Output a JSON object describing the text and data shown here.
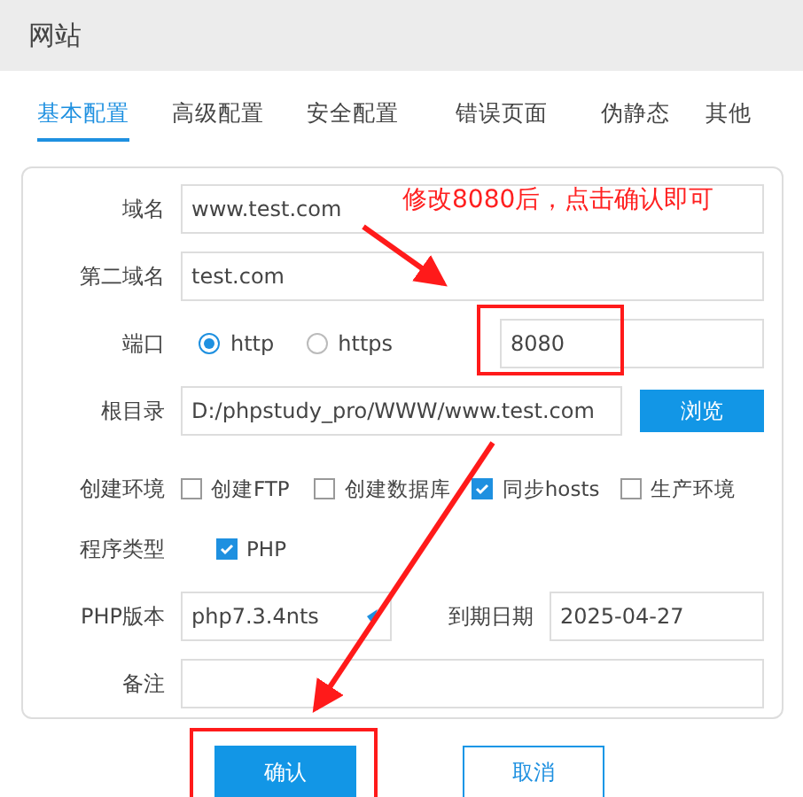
{
  "window": {
    "title": "网站"
  },
  "tabs": [
    {
      "label": "基本配置",
      "selected": true
    },
    {
      "label": "高级配置",
      "selected": false
    },
    {
      "label": "安全配置",
      "selected": false
    },
    {
      "label": "错误页面",
      "selected": false
    },
    {
      "label": "伪静态",
      "selected": false
    },
    {
      "label": "其他",
      "selected": false
    }
  ],
  "form": {
    "domain": {
      "label": "域名",
      "value": "www.test.com"
    },
    "second_domain": {
      "label": "第二域名",
      "value": "test.com"
    },
    "port": {
      "label": "端口",
      "protocols": [
        {
          "label": "http",
          "selected": true
        },
        {
          "label": "https",
          "selected": false
        }
      ],
      "value": "8080"
    },
    "root": {
      "label": "根目录",
      "value": "D:/phpstudy_pro/WWW/www.test.com",
      "button": "浏览"
    },
    "environment": {
      "label": "创建环境",
      "options": [
        {
          "label": "创建FTP",
          "checked": false
        },
        {
          "label": "创建数据库",
          "checked": false
        },
        {
          "label": "同步hosts",
          "checked": true
        },
        {
          "label": "生产环境",
          "checked": false
        }
      ]
    },
    "program_type": {
      "label": "程序类型",
      "options": [
        {
          "label": "PHP",
          "checked": true
        }
      ]
    },
    "php_version": {
      "label": "PHP版本",
      "value": "php7.3.4nts"
    },
    "expiry": {
      "label": "到期日期",
      "value": "2025-04-27"
    },
    "note": {
      "label": "备注"
    }
  },
  "buttons": [
    {
      "label": "确认",
      "kind": "primary"
    },
    {
      "label": "取消",
      "kind": "secondary"
    }
  ],
  "annotation": {
    "text": "修改8080后，点击确认即可"
  }
}
